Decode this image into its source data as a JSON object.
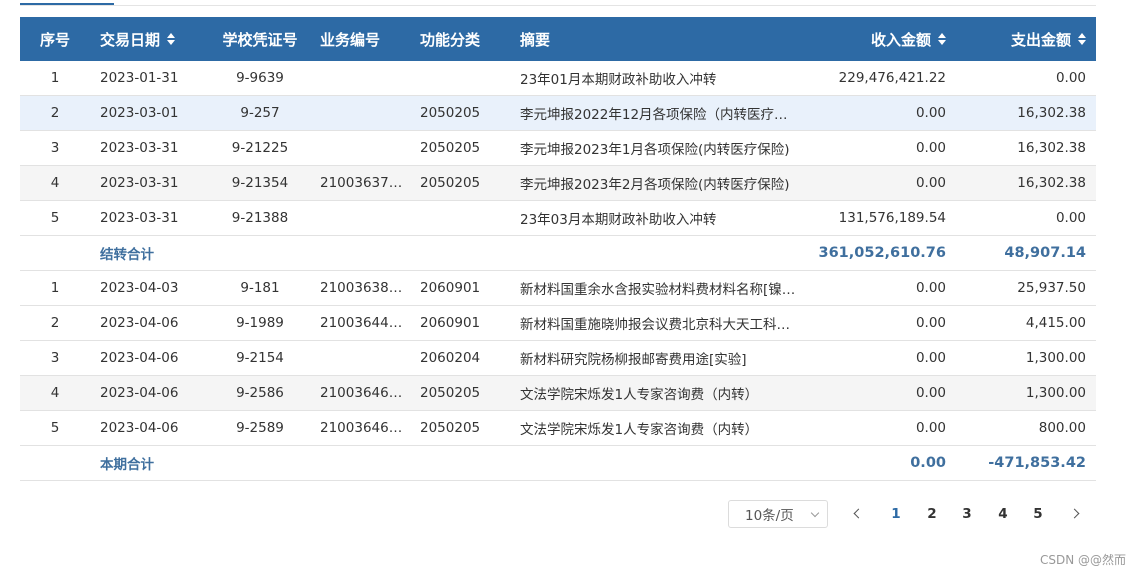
{
  "table": {
    "headers": {
      "idx": "序号",
      "date": "交易日期",
      "voucher": "学校凭证号",
      "biz_no": "业务编号",
      "func": "功能分类",
      "summary": "摘要",
      "income": "收入金额",
      "expense": "支出金额"
    },
    "group1": [
      {
        "idx": "1",
        "date": "2023-01-31",
        "voucher": "9-9639",
        "biz_no": "",
        "func": "",
        "summary": "23年01月本期财政补助收入冲转",
        "income": "229,476,421.22",
        "expense": "0.00"
      },
      {
        "idx": "2",
        "date": "2023-03-01",
        "voucher": "9-257",
        "biz_no": "",
        "func": "2050205",
        "summary": "李元坤报2022年12月各项保险（内转医疗…",
        "income": "0.00",
        "expense": "16,302.38"
      },
      {
        "idx": "3",
        "date": "2023-03-31",
        "voucher": "9-21225",
        "biz_no": "",
        "func": "2050205",
        "summary": "李元坤报2023年1月各项保险(内转医疗保险)",
        "income": "0.00",
        "expense": "16,302.38"
      },
      {
        "idx": "4",
        "date": "2023-03-31",
        "voucher": "9-21354",
        "biz_no": "21003637…",
        "func": "2050205",
        "summary": "李元坤报2023年2月各项保险(内转医疗保险)",
        "income": "0.00",
        "expense": "16,302.38"
      },
      {
        "idx": "5",
        "date": "2023-03-31",
        "voucher": "9-21388",
        "biz_no": "",
        "func": "",
        "summary": "23年03月本期财政补助收入冲转",
        "income": "131,576,189.54",
        "expense": "0.00"
      }
    ],
    "carry_total": {
      "label": "结转合计",
      "income": "361,052,610.76",
      "expense": "48,907.14"
    },
    "group2": [
      {
        "idx": "1",
        "date": "2023-04-03",
        "voucher": "9-181",
        "biz_no": "21003638…",
        "func": "2060901",
        "summary": "新材料国重余水含报实验材料费材料名称[镍…",
        "income": "0.00",
        "expense": "25,937.50"
      },
      {
        "idx": "2",
        "date": "2023-04-06",
        "voucher": "9-1989",
        "biz_no": "21003644…",
        "func": "2060901",
        "summary": "新材料国重施晓帅报会议费北京科大天工科…",
        "income": "0.00",
        "expense": "4,415.00"
      },
      {
        "idx": "3",
        "date": "2023-04-06",
        "voucher": "9-2154",
        "biz_no": "",
        "func": "2060204",
        "summary": "新材料研究院杨柳报邮寄费用途[实验]",
        "income": "0.00",
        "expense": "1,300.00"
      },
      {
        "idx": "4",
        "date": "2023-04-06",
        "voucher": "9-2586",
        "biz_no": "21003646…",
        "func": "2050205",
        "summary": "文法学院宋烁发1人专家咨询费（内转）",
        "income": "0.00",
        "expense": "1,300.00"
      },
      {
        "idx": "5",
        "date": "2023-04-06",
        "voucher": "9-2589",
        "biz_no": "21003646…",
        "func": "2050205",
        "summary": "文法学院宋烁发1人专家咨询费（内转）",
        "income": "0.00",
        "expense": "800.00"
      }
    ],
    "period_total": {
      "label": "本期合计",
      "income": "0.00",
      "expense": "-471,853.42"
    }
  },
  "pagination": {
    "page_size": "10条/页",
    "pages": [
      "1",
      "2",
      "3",
      "4",
      "5"
    ],
    "current": "1"
  },
  "watermark": "CSDN @@然而",
  "colors": {
    "header_bg": "#2d6aa5",
    "total_text": "#3f6f9e",
    "hover_row": "#e9f1fb",
    "alt_row": "#f5f5f5"
  }
}
